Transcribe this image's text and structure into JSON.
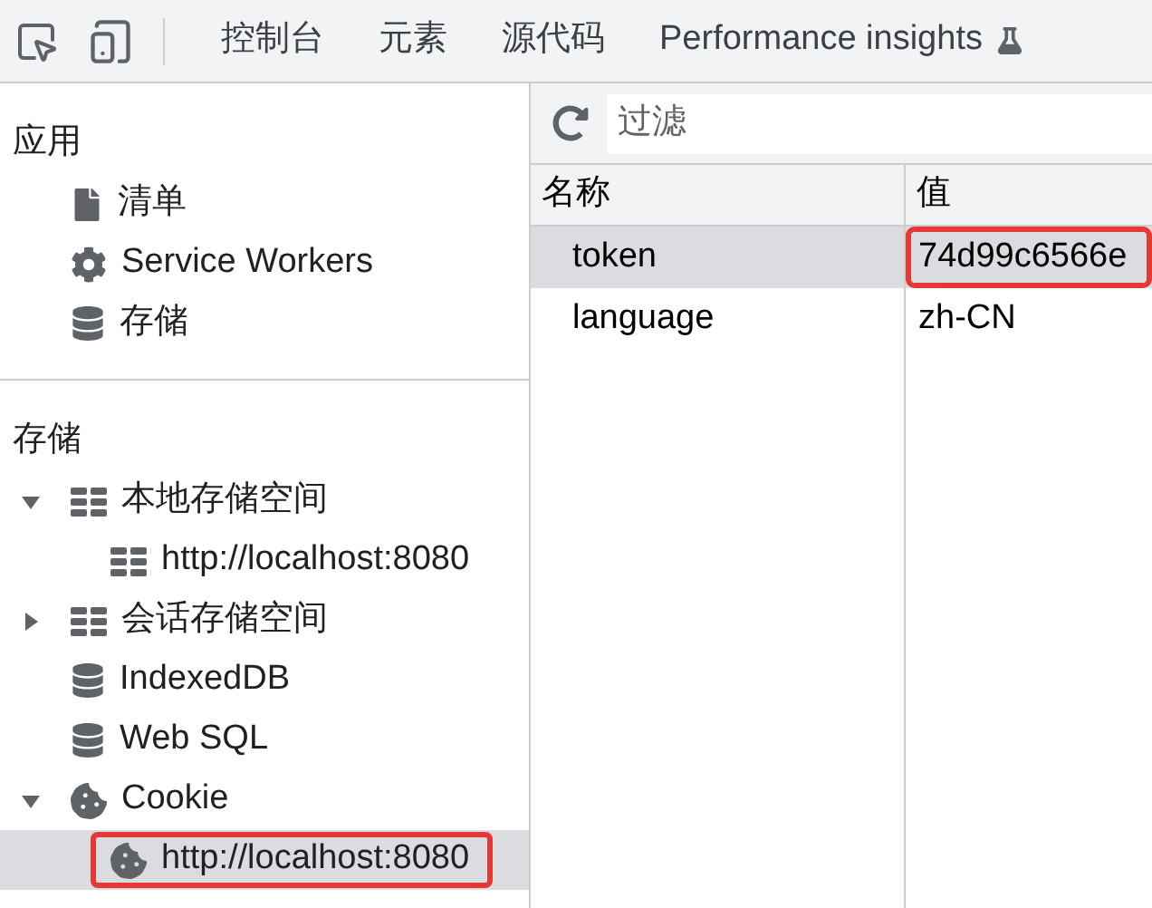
{
  "toolbar": {
    "tabs": [
      {
        "label": "控制台"
      },
      {
        "label": "元素"
      },
      {
        "label": "源代码"
      },
      {
        "label": "Performance insights",
        "kind": "flask"
      }
    ]
  },
  "sidebar": {
    "sections": [
      {
        "title": "应用",
        "items": [
          {
            "label": "清单",
            "kind": "file"
          },
          {
            "label": "Service Workers",
            "kind": "gear"
          },
          {
            "label": "存储",
            "kind": "database"
          }
        ]
      },
      {
        "title": "存储",
        "items": [
          {
            "label": "本地存储空间",
            "kind": "grid",
            "expanded": true,
            "children": [
              {
                "label": "http://localhost:8080",
                "kind": "grid",
                "selected": false,
                "highlighted": false
              }
            ]
          },
          {
            "label": "会话存储空间",
            "kind": "grid",
            "expanded": false
          },
          {
            "label": "IndexedDB",
            "kind": "database"
          },
          {
            "label": "Web SQL",
            "kind": "database"
          },
          {
            "label": "Cookie",
            "kind": "cookie",
            "expanded": true,
            "children": [
              {
                "label": "http://localhost:8080",
                "kind": "cookie",
                "selected": true,
                "highlighted": true
              }
            ]
          }
        ]
      }
    ]
  },
  "table": {
    "filter": {
      "placeholder": "过滤"
    },
    "columns": [
      "名称",
      "值"
    ],
    "rows": [
      {
        "selected": true,
        "cells": [
          {
            "text": "token",
            "highlighted": false
          },
          {
            "text": "74d99c6566e",
            "highlighted": true
          }
        ]
      },
      {
        "selected": false,
        "cells": [
          {
            "text": "language",
            "highlighted": false
          },
          {
            "text": "zh-CN",
            "highlighted": false
          }
        ]
      }
    ]
  }
}
